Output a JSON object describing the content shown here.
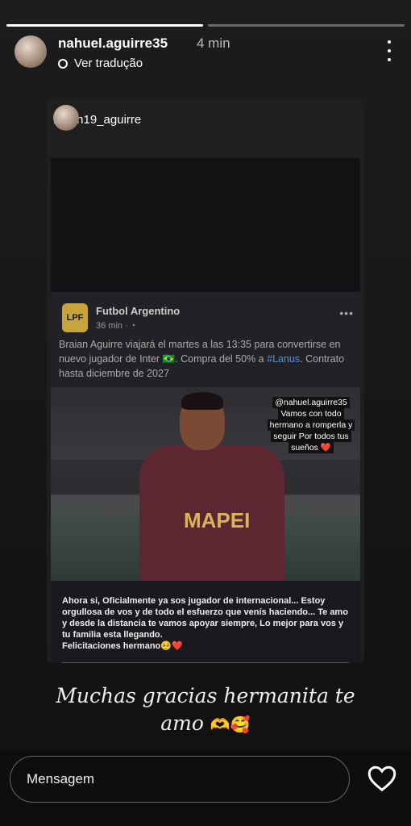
{
  "progress": [
    1.0,
    0.0
  ],
  "header": {
    "username": "nahuel.aguirre35",
    "time": "4 min",
    "translate_label": "Ver tradução"
  },
  "shared_story": {
    "username": "karen19_aguirre",
    "post": {
      "page_name": "Futbol Argentino",
      "logo_text": "LPF",
      "time": "36 min · ◔",
      "text_before_flag": "Braian Aguirre viajará el martes a las 13:35 para convertirse en nuevo jugador de Inter",
      "flag": "🇧🇷",
      "text_middle": ". Compra del 50% a",
      "hashtag": "#Lanus",
      "text_end": ". Contrato hasta diciembre de 2027",
      "more": "•••",
      "photo_sponsor": "MAPEI",
      "mention": "@nahuel.aguirre35",
      "sticker_text": "Vamos con todo hermano a romperla y seguir Por todos tus sueños ❤️",
      "caption": "Ahora si, Oficialmente ya sos jugador de internacional... Estoy orgullosa de vos y de todo el esfuerzo que venís haciendo... Te amo y desde la distancia te vamos apoyar siempre, Lo mejor para vos y tu familia esta llegando.",
      "caption_signoff": "Felicitaciones hermano🥺❤️"
    }
  },
  "reply_text": "Muchas gracias hermanita te amo",
  "reply_emoji": "🫶🥰",
  "composer": {
    "placeholder": "Mensagem"
  },
  "colors": {
    "accent_link": "#5b8fd1",
    "background": "#111111"
  }
}
